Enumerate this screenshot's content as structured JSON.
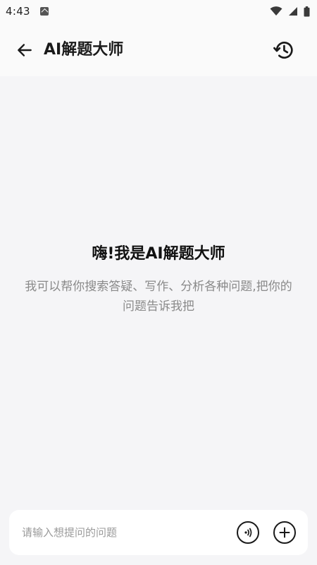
{
  "status_bar": {
    "time": "4:43",
    "icons": [
      "notification-a-icon",
      "wifi-icon",
      "signal-icon",
      "battery-icon"
    ]
  },
  "header": {
    "title": "AI解题大师",
    "back_icon": "arrow-left-icon",
    "history_icon": "history-icon"
  },
  "welcome": {
    "title": "嗨!我是AI解题大师",
    "description": "我可以帮你搜索答疑、写作、分析各种问题,把你的问题告诉我把"
  },
  "composer": {
    "placeholder": "请输入想提问的问题",
    "value": "",
    "voice_icon": "voice-icon",
    "add_icon": "plus-icon"
  },
  "colors": {
    "background": "#f5f5f7",
    "header_background": "#fafafa",
    "title_text": "#1a1a1a",
    "secondary_text": "#8a8a8a",
    "input_background": "#ffffff"
  }
}
